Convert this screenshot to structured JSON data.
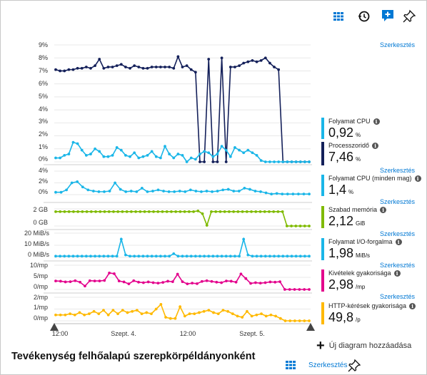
{
  "toolbar": {
    "icons": [
      "grid-icon",
      "history-icon",
      "add-chat-icon",
      "pin-icon"
    ],
    "accent": "#0078d4"
  },
  "edit_label": "Szerkesztés",
  "charts": {
    "main": {
      "ticks": [
        "9%",
        "8%",
        "7%",
        "6%",
        "5%",
        "4%",
        "3%",
        "2%",
        "1%",
        "0%"
      ]
    },
    "proc_core": {
      "ticks": [
        "4%",
        "2%",
        "0%"
      ]
    },
    "memory": {
      "ticks": [
        "2 GB",
        "0 GB"
      ]
    },
    "io": {
      "ticks": [
        "20 MiB/s",
        "10 MiB/s",
        "0 MiB/s"
      ]
    },
    "exceptions": {
      "ticks": [
        "10/mp",
        "5/mp",
        "0/mp"
      ]
    },
    "http": {
      "ticks": [
        "2/mp",
        "1/mp",
        "0/mp"
      ]
    }
  },
  "metrics": [
    {
      "name": "Folyamat CPU",
      "value": "0,92",
      "unit": "%",
      "color": "#1ab6e8"
    },
    {
      "name": "Processzoridő",
      "value": "7,46",
      "unit": "%",
      "color": "#14205a"
    },
    {
      "name": "Folyamat CPU (minden mag)",
      "value": "1,4",
      "unit": "%",
      "color": "#1ab6e8"
    },
    {
      "name": "Szabad memória",
      "value": "2,12",
      "unit": "GiB",
      "color": "#7fba00"
    },
    {
      "name": "Folyamat I/O-forgalma",
      "value": "1,98",
      "unit": "MiB/s",
      "color": "#1ab6e8"
    },
    {
      "name": "Kivételek gyakorisága",
      "value": "2,98",
      "unit": "/mp",
      "color": "#e3008c"
    },
    {
      "name": "HTTP-kérések gyakorisága",
      "value": "49,8",
      "unit": "/p",
      "color": "#ffb900"
    }
  ],
  "x_axis": [
    "12:00",
    "Szept. 4.",
    "12:00",
    "Szept. 5."
  ],
  "footer": {
    "title": "Tevékenység felhőalapú szerepkörpéldányonként",
    "edit": "Szerkesztés",
    "add_chart": "Új diagram hozzáadása"
  },
  "chart_data": [
    {
      "type": "line",
      "ylim": [
        0,
        9
      ],
      "y_ticks": [
        "9%",
        "8%",
        "7%",
        "6%",
        "5%",
        "4%",
        "3%",
        "2%",
        "1%",
        "0%"
      ],
      "series": [
        {
          "name": "Processzoridő",
          "color": "#14205a",
          "values": [
            7.1,
            7.0,
            7.0,
            7.1,
            7.1,
            7.2,
            7.2,
            7.3,
            7.2,
            7.4,
            7.9,
            7.2,
            7.3,
            7.3,
            7.4,
            7.5,
            7.3,
            7.2,
            7.4,
            7.3,
            7.2,
            7.2,
            7.3,
            7.3,
            7.3,
            7.3,
            7.3,
            7.2,
            8.1,
            7.3,
            7.4,
            7.1,
            6.9,
            0,
            0,
            7.9,
            0,
            0,
            8.0,
            0,
            7.3,
            7.3,
            7.4,
            7.6,
            7.7,
            7.8,
            7.7,
            7.8,
            8.0,
            7.6,
            7.3,
            7.1,
            0,
            0,
            0,
            0,
            0,
            0,
            0
          ]
        },
        {
          "name": "Folyamat CPU",
          "color": "#1ab6e8",
          "values": [
            0.3,
            0.3,
            0.5,
            0.6,
            1.5,
            1.4,
            0.9,
            0.5,
            0.6,
            1.0,
            0.8,
            0.4,
            0.4,
            0.5,
            1.1,
            0.9,
            0.5,
            0.4,
            0.7,
            0.3,
            0.4,
            0.5,
            0.8,
            0.4,
            0.3,
            1.2,
            0.6,
            0.3,
            0.6,
            0.5,
            0.0,
            0.3,
            0.2,
            0.6,
            0.8,
            0.7,
            0.4,
            0.6,
            1.2,
            0.9,
            0.4,
            1.1,
            0.9,
            0.7,
            0.9,
            0.7,
            0.5,
            0.1,
            0.0,
            0.0,
            0.0,
            0.0,
            0.0,
            0.0,
            0.0,
            0.0,
            0.0,
            0.0,
            0.0
          ]
        }
      ]
    },
    {
      "type": "line",
      "ylim": [
        0,
        4
      ],
      "y_ticks": [
        "4%",
        "2%",
        "0%"
      ],
      "series": [
        {
          "name": "Folyamat CPU (minden mag)",
          "color": "#1ab6e8",
          "values": [
            0.4,
            0.4,
            0.8,
            2.0,
            2.2,
            1.3,
            0.8,
            0.6,
            0.5,
            0.5,
            0.6,
            2.0,
            0.9,
            0.5,
            0.6,
            0.5,
            1.1,
            0.5,
            0.6,
            0.8,
            0.6,
            0.5,
            0.5,
            0.6,
            0.5,
            0.8,
            0.6,
            0.5,
            0.6,
            0.5,
            0.6,
            0.8,
            0.9,
            0.6,
            0.6,
            1.1,
            0.9,
            0.6,
            0.5,
            0.3,
            0.1,
            0.2,
            0.1,
            0.1,
            0.1,
            0.1,
            0.1,
            0.1
          ]
        }
      ]
    },
    {
      "type": "line",
      "ylim": [
        0,
        2.5
      ],
      "y_ticks": [
        "2 GB",
        "0 GB"
      ],
      "series": [
        {
          "name": "Szabad memória",
          "color": "#7fba00",
          "values": [
            2.1,
            2.1,
            2.1,
            2.1,
            2.1,
            2.1,
            2.1,
            2.1,
            2.1,
            2.1,
            2.1,
            2.1,
            2.1,
            2.1,
            2.1,
            2.1,
            2.1,
            2.1,
            2.1,
            2.1,
            2.1,
            2.1,
            2.1,
            2.1,
            2.1,
            2.1,
            2.1,
            2.1,
            2.1,
            2.1,
            2.1,
            2.1,
            2.2,
            1.8,
            0.1,
            2.1,
            2.1,
            2.1,
            2.1,
            2.1,
            2.1,
            2.1,
            2.1,
            2.1,
            2.1,
            2.1,
            2.1,
            2.1,
            2.1,
            2.1,
            2.1,
            2.1,
            0,
            0,
            0,
            0,
            0,
            0
          ]
        }
      ]
    },
    {
      "type": "line",
      "ylim": [
        0,
        20
      ],
      "y_ticks": [
        "20 MiB/s",
        "10 MiB/s",
        "0 MiB/s"
      ],
      "series": [
        {
          "name": "Folyamat I/O-forgalma",
          "color": "#1ab6e8",
          "values": [
            1,
            1,
            1,
            1,
            1,
            1,
            1,
            1,
            1,
            1,
            1,
            1,
            1,
            1,
            1,
            15,
            2,
            1,
            1,
            1,
            1,
            1,
            1,
            1,
            1,
            1,
            1,
            3,
            1,
            1,
            1,
            1,
            1,
            1,
            1,
            1,
            1,
            1,
            1,
            1,
            1,
            1,
            1,
            15,
            2,
            1,
            1,
            1,
            1,
            1,
            1,
            1,
            1,
            1,
            1,
            1,
            1,
            1,
            1
          ]
        }
      ]
    },
    {
      "type": "line",
      "ylim": [
        0,
        10
      ],
      "y_ticks": [
        "10/mp",
        "5/mp",
        "0/mp"
      ],
      "series": [
        {
          "name": "Kivételek gyakorisága",
          "color": "#e3008c",
          "values": [
            3.5,
            3.4,
            3.1,
            3.2,
            3.6,
            3.0,
            1.4,
            3.6,
            3.5,
            3.5,
            3.7,
            6.8,
            6.5,
            3.5,
            3.1,
            2.3,
            3.6,
            3.0,
            2.8,
            3.1,
            2.8,
            2.6,
            2.9,
            3.4,
            3.2,
            6.3,
            3.2,
            2.3,
            2.6,
            2.4,
            3.3,
            3.6,
            3.3,
            3.0,
            2.8,
            3.5,
            3.4,
            3.0,
            6.4,
            4.5,
            2.5,
            2.8,
            2.6,
            2.8,
            3.1,
            3.0,
            3.2,
            0,
            0,
            0,
            0,
            0,
            0
          ]
        }
      ]
    },
    {
      "type": "line",
      "ylim": [
        0,
        2
      ],
      "y_ticks": [
        "2/mp",
        "1/mp",
        "0/mp"
      ],
      "series": [
        {
          "name": "HTTP-kérések gyakorisága",
          "color": "#ffb900",
          "values": [
            0.5,
            0.5,
            0.5,
            0.6,
            0.5,
            0.7,
            0.5,
            0.6,
            0.8,
            0.6,
            0.9,
            0.5,
            0.9,
            0.6,
            0.9,
            0.7,
            0.8,
            0.9,
            0.6,
            0.7,
            0.6,
            1.0,
            1.4,
            0.3,
            0.2,
            0.2,
            1.2,
            0.4,
            0.6,
            0.6,
            0.7,
            0.8,
            0.9,
            0.7,
            0.6,
            0.9,
            0.8,
            0.6,
            0.4,
            0.3,
            0.8,
            0.4,
            0.5,
            0.6,
            0.4,
            0.5,
            0.4,
            0.2,
            0,
            0,
            0,
            0,
            0,
            0
          ]
        }
      ]
    }
  ]
}
